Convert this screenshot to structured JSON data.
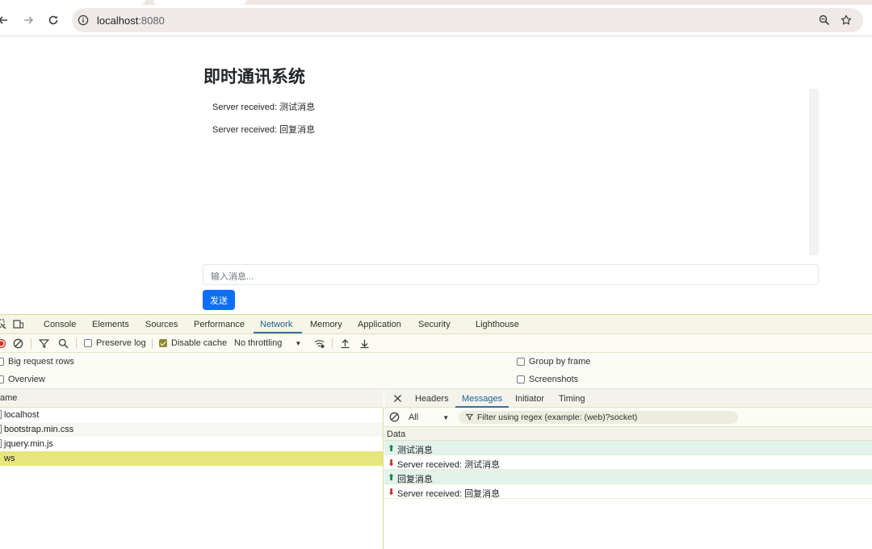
{
  "browser": {
    "url_host": "localhost",
    "url_port": ":8080"
  },
  "page": {
    "title": "即时通讯系统",
    "messages": [
      "Server received: 测试消息",
      "Server received: 回复消息"
    ],
    "input_placeholder": "输入消息...",
    "send_label": "发送"
  },
  "devtools": {
    "tabs": [
      "Console",
      "Elements",
      "Sources",
      "Performance",
      "Network",
      "Memory",
      "Application",
      "Security",
      "Lighthouse"
    ],
    "active_tab": "Network",
    "toolbar": {
      "preserve_log": "Preserve log",
      "disable_cache": "Disable cache",
      "throttling": "No throttling"
    },
    "settings": {
      "big_request_rows": "Big request rows",
      "overview": "Overview",
      "group_by_frame": "Group by frame",
      "screenshots": "Screenshots"
    },
    "request_list": {
      "header": "ame",
      "rows": [
        "localhost",
        "bootstrap.min.css",
        "jquery.min.js",
        "ws"
      ]
    },
    "detail": {
      "tabs": [
        "Headers",
        "Messages",
        "Initiator",
        "Timing"
      ],
      "active_tab": "Messages",
      "filter_type": "All",
      "filter_placeholder": "Filter using regex (example: (web)?socket)",
      "data_header": "Data",
      "frames": [
        {
          "dir": "sent",
          "text": "测试消息"
        },
        {
          "dir": "recv",
          "text": "Server received: 测试消息"
        },
        {
          "dir": "sent",
          "text": "回复消息"
        },
        {
          "dir": "recv",
          "text": "Server received: 回复消息"
        }
      ]
    }
  },
  "colors": {
    "accent": "#0d6efd",
    "devtools_selected_row": "#e6e67c",
    "sent_frame_bg": "#e2f3ec"
  }
}
